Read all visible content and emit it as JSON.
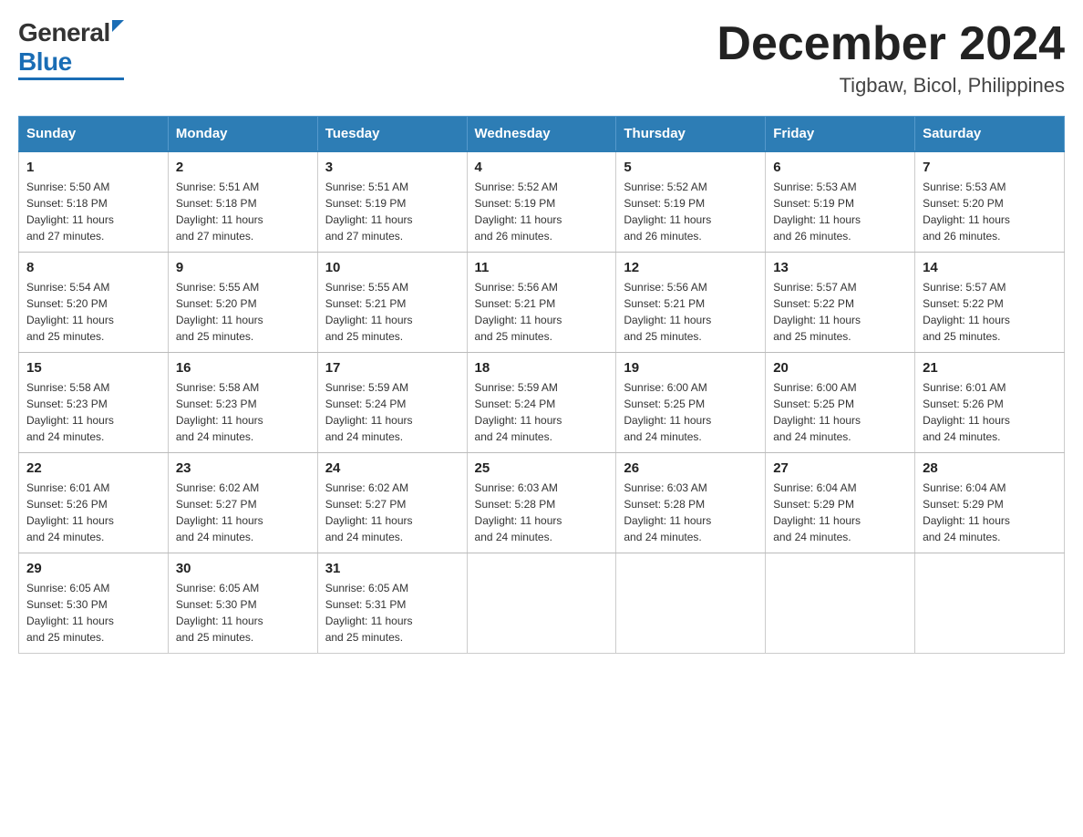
{
  "header": {
    "logo_general": "General",
    "logo_blue": "Blue",
    "month": "December 2024",
    "location": "Tigbaw, Bicol, Philippines"
  },
  "weekdays": [
    "Sunday",
    "Monday",
    "Tuesday",
    "Wednesday",
    "Thursday",
    "Friday",
    "Saturday"
  ],
  "weeks": [
    [
      {
        "day": "1",
        "sunrise": "5:50 AM",
        "sunset": "5:18 PM",
        "daylight": "11 hours and 27 minutes."
      },
      {
        "day": "2",
        "sunrise": "5:51 AM",
        "sunset": "5:18 PM",
        "daylight": "11 hours and 27 minutes."
      },
      {
        "day": "3",
        "sunrise": "5:51 AM",
        "sunset": "5:19 PM",
        "daylight": "11 hours and 27 minutes."
      },
      {
        "day": "4",
        "sunrise": "5:52 AM",
        "sunset": "5:19 PM",
        "daylight": "11 hours and 26 minutes."
      },
      {
        "day": "5",
        "sunrise": "5:52 AM",
        "sunset": "5:19 PM",
        "daylight": "11 hours and 26 minutes."
      },
      {
        "day": "6",
        "sunrise": "5:53 AM",
        "sunset": "5:19 PM",
        "daylight": "11 hours and 26 minutes."
      },
      {
        "day": "7",
        "sunrise": "5:53 AM",
        "sunset": "5:20 PM",
        "daylight": "11 hours and 26 minutes."
      }
    ],
    [
      {
        "day": "8",
        "sunrise": "5:54 AM",
        "sunset": "5:20 PM",
        "daylight": "11 hours and 25 minutes."
      },
      {
        "day": "9",
        "sunrise": "5:55 AM",
        "sunset": "5:20 PM",
        "daylight": "11 hours and 25 minutes."
      },
      {
        "day": "10",
        "sunrise": "5:55 AM",
        "sunset": "5:21 PM",
        "daylight": "11 hours and 25 minutes."
      },
      {
        "day": "11",
        "sunrise": "5:56 AM",
        "sunset": "5:21 PM",
        "daylight": "11 hours and 25 minutes."
      },
      {
        "day": "12",
        "sunrise": "5:56 AM",
        "sunset": "5:21 PM",
        "daylight": "11 hours and 25 minutes."
      },
      {
        "day": "13",
        "sunrise": "5:57 AM",
        "sunset": "5:22 PM",
        "daylight": "11 hours and 25 minutes."
      },
      {
        "day": "14",
        "sunrise": "5:57 AM",
        "sunset": "5:22 PM",
        "daylight": "11 hours and 25 minutes."
      }
    ],
    [
      {
        "day": "15",
        "sunrise": "5:58 AM",
        "sunset": "5:23 PM",
        "daylight": "11 hours and 24 minutes."
      },
      {
        "day": "16",
        "sunrise": "5:58 AM",
        "sunset": "5:23 PM",
        "daylight": "11 hours and 24 minutes."
      },
      {
        "day": "17",
        "sunrise": "5:59 AM",
        "sunset": "5:24 PM",
        "daylight": "11 hours and 24 minutes."
      },
      {
        "day": "18",
        "sunrise": "5:59 AM",
        "sunset": "5:24 PM",
        "daylight": "11 hours and 24 minutes."
      },
      {
        "day": "19",
        "sunrise": "6:00 AM",
        "sunset": "5:25 PM",
        "daylight": "11 hours and 24 minutes."
      },
      {
        "day": "20",
        "sunrise": "6:00 AM",
        "sunset": "5:25 PM",
        "daylight": "11 hours and 24 minutes."
      },
      {
        "day": "21",
        "sunrise": "6:01 AM",
        "sunset": "5:26 PM",
        "daylight": "11 hours and 24 minutes."
      }
    ],
    [
      {
        "day": "22",
        "sunrise": "6:01 AM",
        "sunset": "5:26 PM",
        "daylight": "11 hours and 24 minutes."
      },
      {
        "day": "23",
        "sunrise": "6:02 AM",
        "sunset": "5:27 PM",
        "daylight": "11 hours and 24 minutes."
      },
      {
        "day": "24",
        "sunrise": "6:02 AM",
        "sunset": "5:27 PM",
        "daylight": "11 hours and 24 minutes."
      },
      {
        "day": "25",
        "sunrise": "6:03 AM",
        "sunset": "5:28 PM",
        "daylight": "11 hours and 24 minutes."
      },
      {
        "day": "26",
        "sunrise": "6:03 AM",
        "sunset": "5:28 PM",
        "daylight": "11 hours and 24 minutes."
      },
      {
        "day": "27",
        "sunrise": "6:04 AM",
        "sunset": "5:29 PM",
        "daylight": "11 hours and 24 minutes."
      },
      {
        "day": "28",
        "sunrise": "6:04 AM",
        "sunset": "5:29 PM",
        "daylight": "11 hours and 24 minutes."
      }
    ],
    [
      {
        "day": "29",
        "sunrise": "6:05 AM",
        "sunset": "5:30 PM",
        "daylight": "11 hours and 25 minutes."
      },
      {
        "day": "30",
        "sunrise": "6:05 AM",
        "sunset": "5:30 PM",
        "daylight": "11 hours and 25 minutes."
      },
      {
        "day": "31",
        "sunrise": "6:05 AM",
        "sunset": "5:31 PM",
        "daylight": "11 hours and 25 minutes."
      },
      null,
      null,
      null,
      null
    ]
  ],
  "labels": {
    "sunrise": "Sunrise: ",
    "sunset": "Sunset: ",
    "daylight": "Daylight: "
  }
}
